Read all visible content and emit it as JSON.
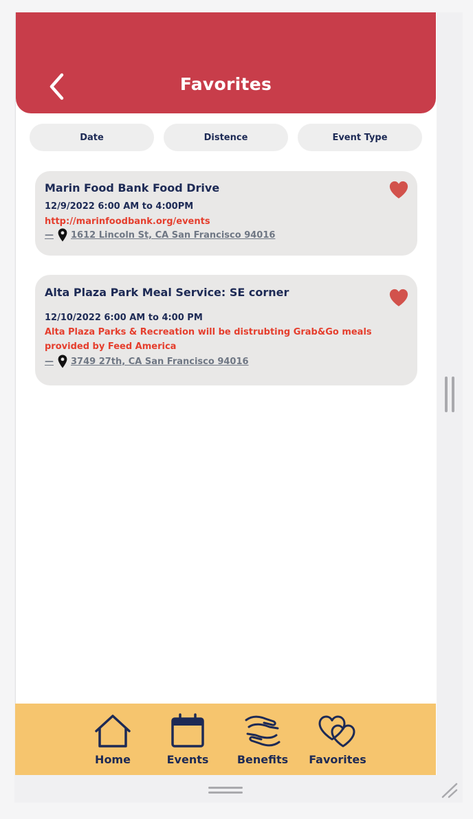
{
  "header": {
    "title": "Favorites",
    "back_icon": "chevron-left-icon"
  },
  "filters": [
    {
      "label": "Date"
    },
    {
      "label": "Distence"
    },
    {
      "label": "Event Type"
    }
  ],
  "events": [
    {
      "title": "Marin Food Bank Food Drive",
      "datetime": "12/9/2022 6:00 AM to 4:00PM",
      "detail": "http://marinfoodbank.org/events",
      "dash": "—",
      "address": "1612 Lincoln St, CA San Francisco 94016",
      "favorite_icon": "heart-icon"
    },
    {
      "title": "Alta Plaza Park Meal Service: SE corner",
      "datetime": "12/10/2022 6:00 AM to 4:00 PM",
      "detail": "Alta Plaza Parks & Recreation will be distrubting Grab&Go meals provided by Feed America",
      "dash": "—",
      "address": "3749 27th, CA San Francisco 94016",
      "favorite_icon": "heart-icon"
    }
  ],
  "nav": [
    {
      "label": "Home",
      "icon": "home-icon"
    },
    {
      "label": "Events",
      "icon": "calendar-icon"
    },
    {
      "label": "Benefits",
      "icon": "hands-icon"
    },
    {
      "label": "Favorites",
      "icon": "hearts-icon"
    }
  ],
  "colors": {
    "header_red": "#c83d4a",
    "navy": "#1d2a55",
    "accent_red": "#e53e2d",
    "heart_red": "#d2524c",
    "card_bg": "#e9e8e7",
    "nav_bg": "#f6c56e"
  }
}
